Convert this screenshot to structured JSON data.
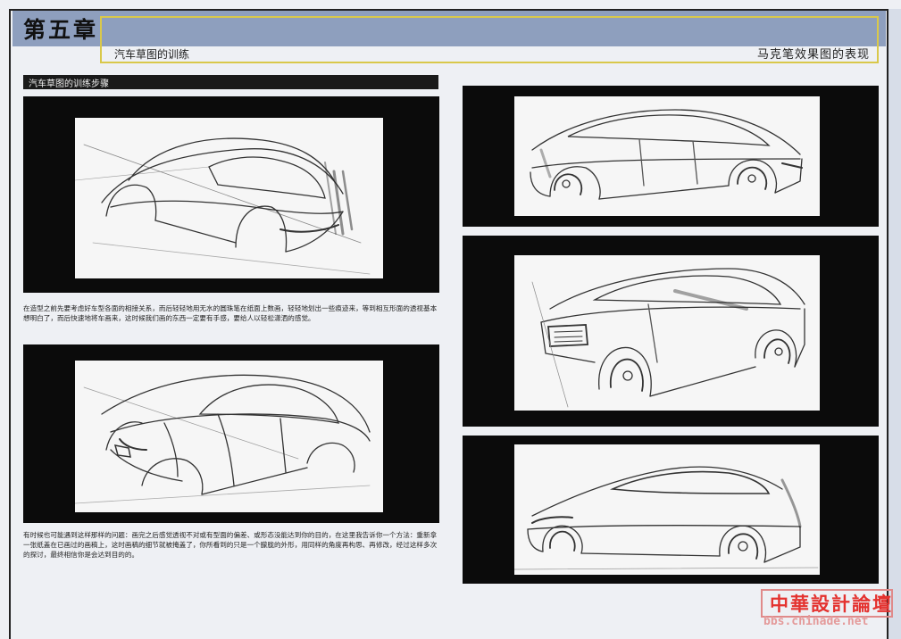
{
  "header": {
    "chapter_title": "第五章"
  },
  "subtitle": {
    "left": "汽车草图的训练",
    "right": "马克笔效果图的表现"
  },
  "section": {
    "label": "汽车草图的训练步骤"
  },
  "paragraphs": {
    "first": "在造型之前先要考虑好车型各面的相接关系，而后轻轻地用无水的圆珠笔在纸面上数画，轻轻地划出一些痕迹来，等到相互形面的透视基本想明白了，而后快速地将车画来，这时候我们画的东西一定要有手感，要给人以轻松潇洒的感觉。",
    "second": "有时候也可能遇到这样那样的问题：画完之后感觉透视不对或有型面的偏差、或形态没能达到你的目的，在这里我告诉你一个方法：重新拿一张纸盖在已画过的画稿上，这时画稿的细节就被掩盖了，你所看到的只是一个朦胧的外形，用同样的角度再构思、再修改，经过这样多次的探讨，最终相信你是会达到目的的。"
  },
  "watermark": {
    "name": "中華設計論壇",
    "url": "bbs.chinade.net"
  },
  "colors": {
    "header_bar": "#8e9fbe",
    "frame_accent": "#d9c84a",
    "panel": "#0b0b0b",
    "watermark": "#e4322f"
  }
}
